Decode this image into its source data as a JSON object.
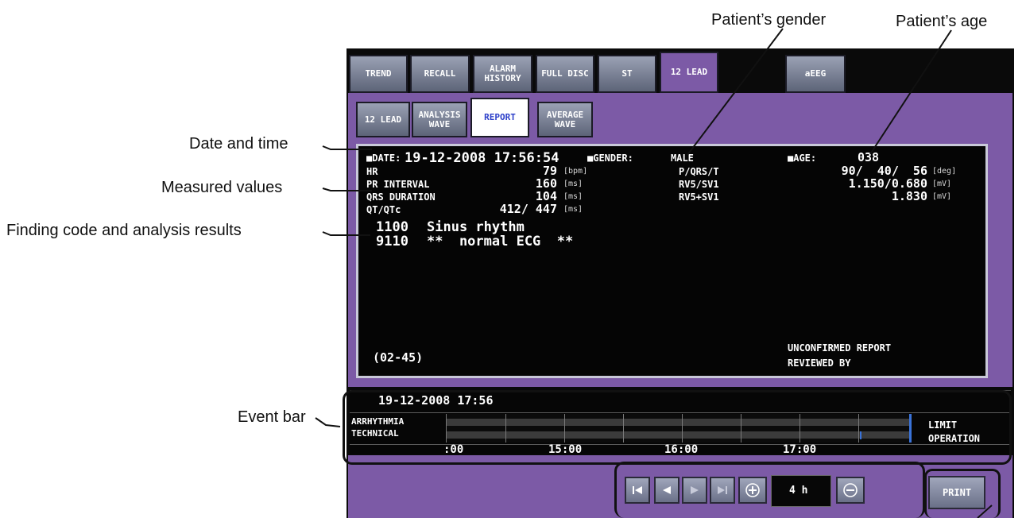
{
  "callouts": {
    "gender": "Patient’s gender",
    "age": "Patient’s age",
    "datetime": "Date and time",
    "measured": "Measured values",
    "finding": "Finding code and analysis results",
    "event_bar": "Event bar"
  },
  "tabs": [
    "TREND",
    "RECALL",
    "ALARM HISTORY",
    "FULL DISC",
    "ST",
    "12 LEAD",
    "aEEG"
  ],
  "active_tab": "12 LEAD",
  "subtabs": [
    "12 LEAD",
    "ANALYSIS WAVE",
    "REPORT",
    "AVERAGE WAVE"
  ],
  "active_subtab": "REPORT",
  "report": {
    "date_label": "■DATE:",
    "date_value": "19-12-2008 17:56:54",
    "gender_label": "■GENDER:",
    "gender_value": "MALE",
    "age_label": "■AGE:",
    "age_value": "038",
    "left_rows": [
      {
        "label": "HR",
        "value": "79",
        "unit": "[bpm]"
      },
      {
        "label": "PR INTERVAL",
        "value": "160",
        "unit": "[ms]"
      },
      {
        "label": "QRS DURATION",
        "value": "104",
        "unit": "[ms]"
      },
      {
        "label": "QT/QTc",
        "value": "412/ 447",
        "unit": "[ms]"
      }
    ],
    "right_rows": [
      {
        "label": "P/QRS/T",
        "value": "90/  40/  56",
        "unit": "[deg]"
      },
      {
        "label": "RV5/SV1",
        "value": "1.150/0.680",
        "unit": "[mV]"
      },
      {
        "label": "RV5+SV1",
        "value": "1.830",
        "unit": "[mV]"
      }
    ],
    "findings": [
      {
        "code": "1100",
        "text": "Sinus rhythm"
      },
      {
        "code": "9110",
        "text": "**  normal ECG  **"
      }
    ],
    "footer_code": "(02-45)",
    "unconfirmed": "UNCONFIRMED REPORT",
    "reviewed": "REVIEWED BY"
  },
  "event_bar": {
    "datetime": "19-12-2008 17:56",
    "rows": [
      "ARRHYTHMIA",
      "TECHNICAL"
    ],
    "limit": "LIMIT",
    "operation": "OPERATION",
    "time_ticks": [
      ":00",
      "15:00",
      "16:00",
      "17:00"
    ]
  },
  "nav": {
    "first_icon": "skip-first-icon",
    "prev_icon": "play-left-icon",
    "next_icon": "play-right-icon",
    "last_icon": "skip-last-icon",
    "zoom_in_icon": "plus-circle-icon",
    "zoom_out_icon": "minus-circle-icon",
    "span": "4 h",
    "print": "PRINT"
  },
  "colors": {
    "accent_purple": "#7c5aa6",
    "tab_gray": "#7f869b",
    "active_subtab_text": "#2c3fc9",
    "marker_blue": "#3a73d9"
  }
}
